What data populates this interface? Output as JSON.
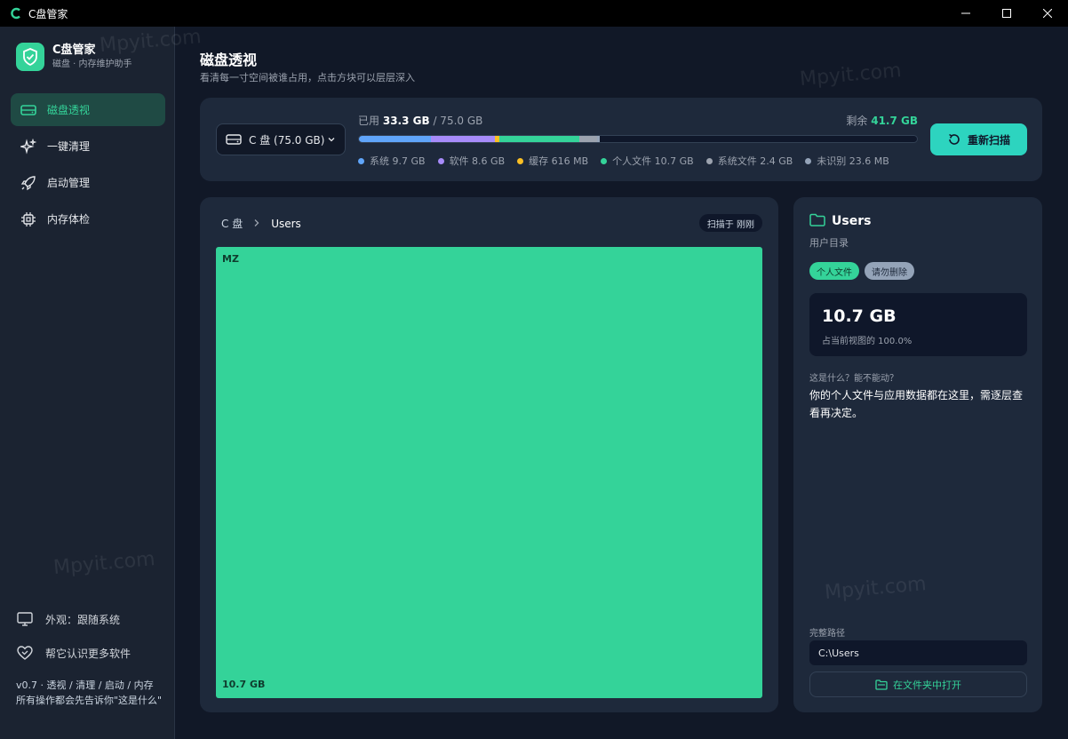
{
  "window": {
    "title": "C盘管家"
  },
  "brand": {
    "name": "C盘管家",
    "subtitle": "磁盘 · 内存维护助手"
  },
  "nav": {
    "items": [
      {
        "label": "磁盘透视",
        "icon": "drive-icon",
        "active": true
      },
      {
        "label": "一键清理",
        "icon": "sparkle-icon",
        "active": false
      },
      {
        "label": "启动管理",
        "icon": "rocket-icon",
        "active": false
      },
      {
        "label": "内存体检",
        "icon": "chip-icon",
        "active": false
      }
    ]
  },
  "sidebar_bottom": {
    "appearance": "外观：跟随系统",
    "help": "帮它认识更多软件",
    "note": "v0.7 · 透视 / 清理 / 启动 / 内存 所有操作都会先告诉你\"这是什么\""
  },
  "header": {
    "title": "磁盘透视",
    "subtitle": "看清每一寸空间被谁占用，点击方块可以层层深入"
  },
  "disk": {
    "selector": "C 盘 (75.0 GB)",
    "used_prefix": "已用",
    "used": "33.3 GB",
    "total": "/ 75.0 GB",
    "free_prefix": "剩余",
    "free": "41.7 GB",
    "rescan": "重新扫描",
    "total_gb": 75.0,
    "segments": [
      {
        "label": "系统 9.7 GB",
        "gb": 9.7,
        "color": "#60a5fa"
      },
      {
        "label": "软件 8.6 GB",
        "gb": 8.6,
        "color": "#a78bfa"
      },
      {
        "label": "缓存 616 MB",
        "gb": 0.6,
        "color": "#fbbf24"
      },
      {
        "label": "个人文件 10.7 GB",
        "gb": 10.7,
        "color": "#34d399"
      },
      {
        "label": "系统文件 2.4 GB",
        "gb": 2.4,
        "color": "#9ca3af"
      },
      {
        "label": "未识别 23.6 MB",
        "gb": 0.02,
        "color": "#94a3b8"
      }
    ]
  },
  "tree": {
    "crumbs": [
      "C 盘",
      "Users"
    ],
    "scan_badge": "扫描于 刚刚",
    "block_name": "MZ",
    "block_size": "10.7 GB"
  },
  "detail": {
    "title": "Users",
    "subtitle": "用户目录",
    "tags": [
      "个人文件",
      "请勿删除"
    ],
    "size": "10.7 GB",
    "pct": "占当前视图的 100.0%",
    "q_label": "这是什么？能不能动？",
    "q_text": "你的个人文件与应用数据都在这里，需逐层查看再决定。",
    "path_label": "完整路径",
    "path": "C:\\Users",
    "open_btn": "在文件夹中打开"
  },
  "watermark": "Mpyit.com"
}
